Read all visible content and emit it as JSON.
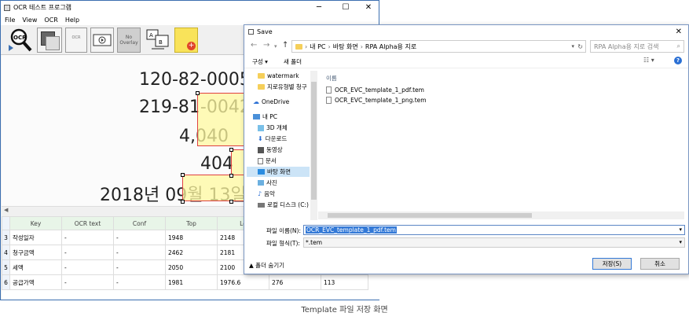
{
  "main_window": {
    "title": "OCR 테스트 프로그램",
    "menu": [
      "File",
      "View",
      "OCR",
      "Help"
    ],
    "toolbar": {
      "ocr_label": "OCR",
      "no_overlay": "No\nOverlay",
      "ocr_small": "OCR"
    },
    "scan_text": [
      "120-82-0005",
      "219-81-0042",
      "4,040",
      "404",
      "2018년 09월 13일"
    ],
    "grid": {
      "columns": [
        "Key",
        "OCR text",
        "Conf",
        "Top",
        "Le"
      ],
      "rows": [
        {
          "num": "3",
          "key": "작성일자",
          "ocr": "-",
          "conf": "-",
          "top": "1948",
          "left": "2148",
          "w": "",
          "h": ""
        },
        {
          "num": "4",
          "key": "청구금액",
          "ocr": "-",
          "conf": "-",
          "top": "2462",
          "left": "2181",
          "w": "",
          "h": ""
        },
        {
          "num": "5",
          "key": "세액",
          "ocr": "-",
          "conf": "-",
          "top": "2050",
          "left": "2100",
          "w": "",
          "h": ""
        },
        {
          "num": "6",
          "key": "공급가액",
          "ocr": "-",
          "conf": "-",
          "top": "1981",
          "left": "1976.6",
          "w": "276",
          "h": "113"
        }
      ]
    }
  },
  "dialog": {
    "title": "Save",
    "breadcrumb": [
      "내 PC",
      "바탕 화면",
      "RPA Alpha용 지로"
    ],
    "search_placeholder": "RPA Alpha용 지로 검색",
    "organize": "구성 ▾",
    "new_folder": "새 폴더",
    "tree": [
      {
        "label": "watermark",
        "icon": "folder-icon"
      },
      {
        "label": "지로유형별 청구",
        "icon": "folder-icon"
      },
      {
        "label": "OneDrive",
        "icon": "cloud-icon"
      },
      {
        "label": "내 PC",
        "icon": "pc-icon"
      },
      {
        "label": "3D 개체",
        "icon": "cube-icon"
      },
      {
        "label": "다운로드",
        "icon": "download-icon"
      },
      {
        "label": "동영상",
        "icon": "video-icon"
      },
      {
        "label": "문서",
        "icon": "document-icon"
      },
      {
        "label": "바탕 화면",
        "icon": "desktop-icon"
      },
      {
        "label": "사진",
        "icon": "picture-icon"
      },
      {
        "label": "음악",
        "icon": "music-icon"
      },
      {
        "label": "로컬 디스크 (C:)",
        "icon": "disk-icon"
      }
    ],
    "column_header": "이름",
    "files": [
      "OCR_EVC_template_1_pdf.tem",
      "OCR_EVC_template_1_png.tem"
    ],
    "filename_label": "파일 이름(N):",
    "filename_value": "OCR_EVC_template_1_pdf.tem",
    "filetype_label": "파일 형식(T):",
    "filetype_value": "*.tem",
    "hide_folders": "폴더 숨기기",
    "save_button": "저장(S)",
    "cancel_button": "취소"
  },
  "caption": "Template 파일 저장 화면"
}
